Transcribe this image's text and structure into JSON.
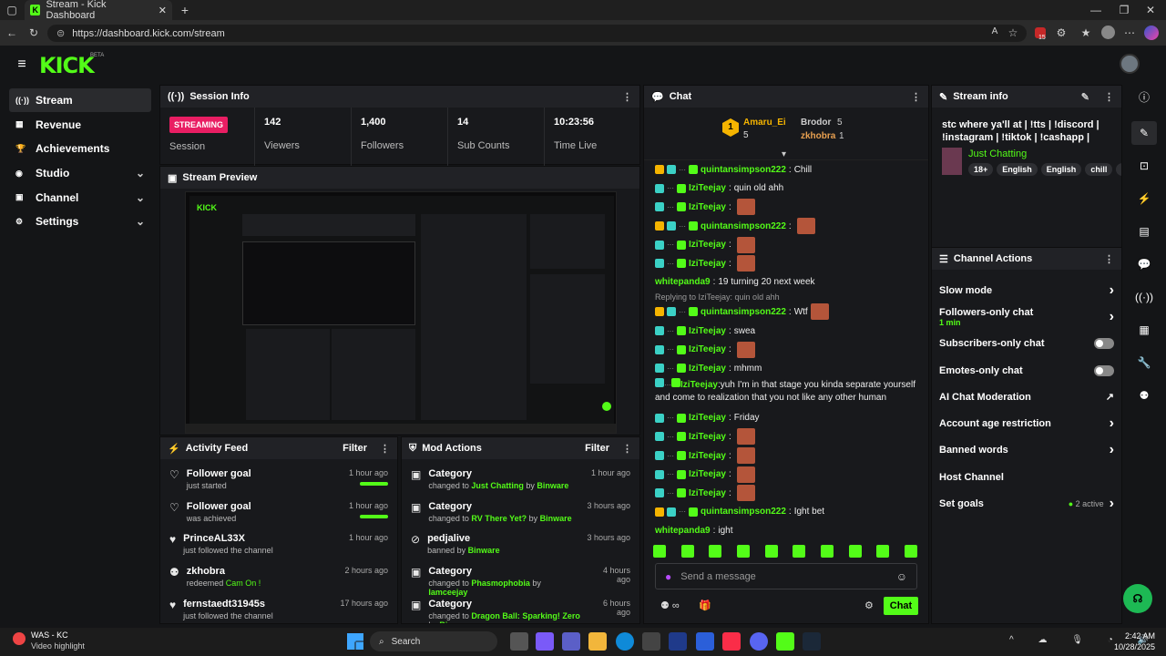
{
  "browser": {
    "tab_title": "Stream - Kick Dashboard",
    "url": "https://dashboard.kick.com/stream",
    "ext_badge": "15"
  },
  "app": {
    "logo": "KICK",
    "beta": "BETA"
  },
  "nav": [
    {
      "label": "Stream",
      "icon": "stream-icon",
      "active": true
    },
    {
      "label": "Revenue",
      "icon": "revenue-icon"
    },
    {
      "label": "Achievements",
      "icon": "trophy-icon"
    },
    {
      "label": "Studio",
      "icon": "studio-icon",
      "chevron": true
    },
    {
      "label": "Channel",
      "icon": "channel-icon",
      "chevron": true
    },
    {
      "label": "Settings",
      "icon": "gear-icon",
      "chevron": true
    }
  ],
  "session": {
    "title": "Session Info",
    "status": "STREAMING",
    "status_label": "Session",
    "stats": [
      {
        "value": "142",
        "label": "Viewers"
      },
      {
        "value": "1,400",
        "label": "Followers"
      },
      {
        "value": "14",
        "label": "Sub Counts"
      },
      {
        "value": "10:23:56",
        "label": "Time Live"
      }
    ]
  },
  "preview": {
    "title": "Stream Preview"
  },
  "activity": {
    "title": "Activity Feed",
    "filter": "Filter",
    "items": [
      {
        "title": "Follower goal",
        "sub": "just started",
        "time": "1 hour ago",
        "bar": true
      },
      {
        "title": "Follower goal",
        "sub": "was achieved",
        "time": "1 hour ago",
        "bar": true
      },
      {
        "title": "PrinceAL33X",
        "sub": "just followed the channel",
        "time": "1 hour ago"
      },
      {
        "title": "zkhobra",
        "sub_pre": "redeemed ",
        "sub_hl": "Cam On !",
        "time": "2 hours ago"
      },
      {
        "title": "fernstaedt31945s",
        "sub": "just followed the channel",
        "time": "17 hours ago"
      }
    ]
  },
  "mod": {
    "title": "Mod Actions",
    "filter": "Filter",
    "items": [
      {
        "title": "Category",
        "pre": "changed to ",
        "hl": "Just Chatting",
        "mid": " by ",
        "by": "Binware",
        "time": "1 hour ago"
      },
      {
        "title": "Category",
        "pre": "changed to ",
        "hl": "RV There Yet?",
        "mid": " by ",
        "by": "Binware",
        "time": "3 hours ago"
      },
      {
        "title": "pedjalive",
        "pre": "banned by ",
        "hl": "",
        "mid": "",
        "by": "Binware",
        "time": "3 hours ago"
      },
      {
        "title": "Category",
        "pre": "changed to ",
        "hl": "Phasmophobia",
        "mid": " by ",
        "by": "Iamceejay",
        "time": "4 hours ago"
      },
      {
        "title": "Category",
        "pre": "changed to ",
        "hl": "Dragon Ball: Sparking! Zero",
        "mid": " by ",
        "by": "Binware",
        "time": "6 hours ago"
      }
    ]
  },
  "chat": {
    "title": "Chat",
    "top": [
      {
        "rank": "1",
        "name": "Amaru_Ei",
        "count": "5"
      },
      {
        "name": "Brodor",
        "count": "5"
      },
      {
        "name": "zkhobra",
        "count": "1"
      }
    ],
    "messages": [
      {
        "user": "quintansimpson222",
        "color": "#53fc18",
        "text": "Chill",
        "crown": true
      },
      {
        "user": "IziTeejay",
        "color": "#53fc18",
        "text": "quin old ahh"
      },
      {
        "user": "IziTeejay",
        "color": "#53fc18",
        "text": "",
        "emote": true
      },
      {
        "user": "quintansimpson222",
        "color": "#53fc18",
        "text": "",
        "emote": true,
        "crown": true
      },
      {
        "user": "IziTeejay",
        "color": "#53fc18",
        "text": "",
        "emote": true
      },
      {
        "user": "IziTeejay",
        "color": "#53fc18",
        "text": "",
        "emote": true
      },
      {
        "user": "whitepanda9",
        "color": "#53fc18",
        "text": "19 turning 20 next week",
        "plain": true
      },
      {
        "reply": "Replying to IziTeejay: quin old ahh"
      },
      {
        "user": "quintansimpson222",
        "color": "#53fc18",
        "text": "Wtf",
        "emote": true,
        "crown": true
      },
      {
        "user": "IziTeejay",
        "color": "#53fc18",
        "text": "swea"
      },
      {
        "user": "IziTeejay",
        "color": "#53fc18",
        "text": "",
        "emote": true
      },
      {
        "user": "IziTeejay",
        "color": "#53fc18",
        "text": "mhmm"
      },
      {
        "user": "IziTeejay",
        "color": "#53fc18",
        "text": "yuh I'm in that stage you kinda separate yourself and come to realization that you not like any other human",
        "long": true
      },
      {
        "user": "IziTeejay",
        "color": "#53fc18",
        "text": "Friday"
      },
      {
        "user": "IziTeejay",
        "color": "#53fc18",
        "text": "",
        "emote": true
      },
      {
        "user": "IziTeejay",
        "color": "#53fc18",
        "text": "",
        "emote": true
      },
      {
        "user": "IziTeejay",
        "color": "#53fc18",
        "text": "",
        "emote": true
      },
      {
        "user": "IziTeejay",
        "color": "#53fc18",
        "text": "",
        "emote": true
      },
      {
        "user": "quintansimpson222",
        "color": "#53fc18",
        "text": "Ight bet",
        "crown": true
      },
      {
        "user": "whitepanda9",
        "color": "#53fc18",
        "text": "ight",
        "plain": true
      }
    ],
    "placeholder": "Send a message",
    "send": "Chat"
  },
  "info": {
    "title": "Stream info",
    "text": "stc where ya'll at | !tts | !discord | !instagram | !tiktok | !cashapp |",
    "category": "Just Chatting",
    "tags": [
      "18+",
      "English",
      "English",
      "chill",
      "fu"
    ]
  },
  "actions": {
    "title": "Channel Actions",
    "items": [
      {
        "label": "Slow mode",
        "type": "chev"
      },
      {
        "label": "Followers-only chat",
        "sub": "1 min",
        "type": "chev"
      },
      {
        "label": "Subscribers-only chat",
        "type": "toggle"
      },
      {
        "label": "Emotes-only chat",
        "type": "toggle"
      },
      {
        "label": "AI Chat Moderation",
        "type": "ext"
      },
      {
        "label": "Account age restriction",
        "type": "chev"
      },
      {
        "label": "Banned words",
        "type": "chev"
      },
      {
        "label": "Host Channel",
        "type": "none"
      },
      {
        "label": "Set goals",
        "type": "chev",
        "status": "2 active"
      }
    ]
  },
  "taskbar": {
    "app_title": "WAS - KC",
    "app_sub": "Video highlight",
    "search": "Search",
    "time": "2:42 AM",
    "date": "10/28/2025"
  },
  "colors": {
    "accent": "#53fc18",
    "live": "#e91e63"
  }
}
